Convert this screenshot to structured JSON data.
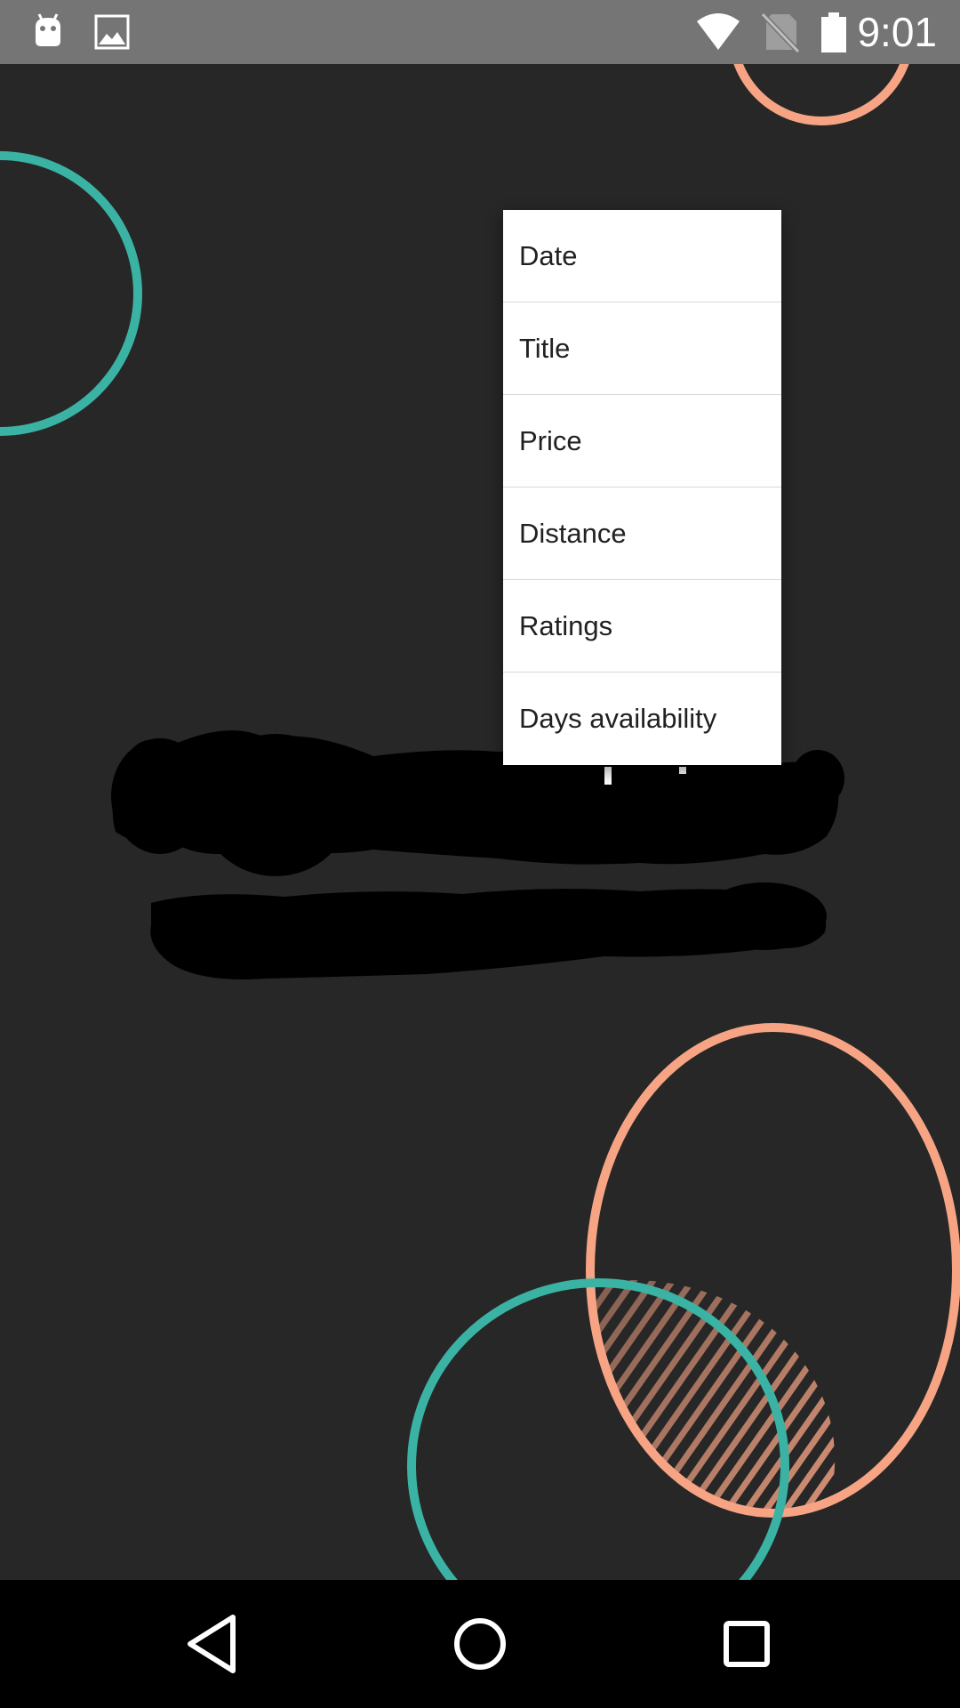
{
  "status_bar": {
    "time": "9:01",
    "left_icons": [
      "android-icon",
      "image-icon"
    ],
    "right_icons": [
      "wifi-icon",
      "no-sim-icon",
      "battery-icon"
    ],
    "background": "#757575"
  },
  "background": {
    "color": "#272727",
    "accent_teal": "#3bb3a4",
    "accent_salmon": "#f7a484"
  },
  "sort_menu": {
    "items": [
      {
        "label": "Date"
      },
      {
        "label": "Title"
      },
      {
        "label": "Price"
      },
      {
        "label": "Distance"
      },
      {
        "label": "Ratings"
      },
      {
        "label": "Days availability"
      }
    ]
  },
  "nav_bar": {
    "buttons": [
      "back-icon",
      "home-icon",
      "recents-icon"
    ]
  }
}
